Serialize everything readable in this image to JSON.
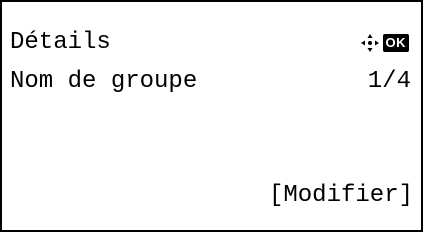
{
  "screen": {
    "title": "Détails",
    "item_label": "Nom de groupe",
    "page_counter": "1/4",
    "softkey_label": "[Modifier]",
    "ok_label": "OK",
    "nav_icon": "dpad-arrows-icon",
    "colors": {
      "foreground": "#000000",
      "background": "#ffffff"
    }
  }
}
